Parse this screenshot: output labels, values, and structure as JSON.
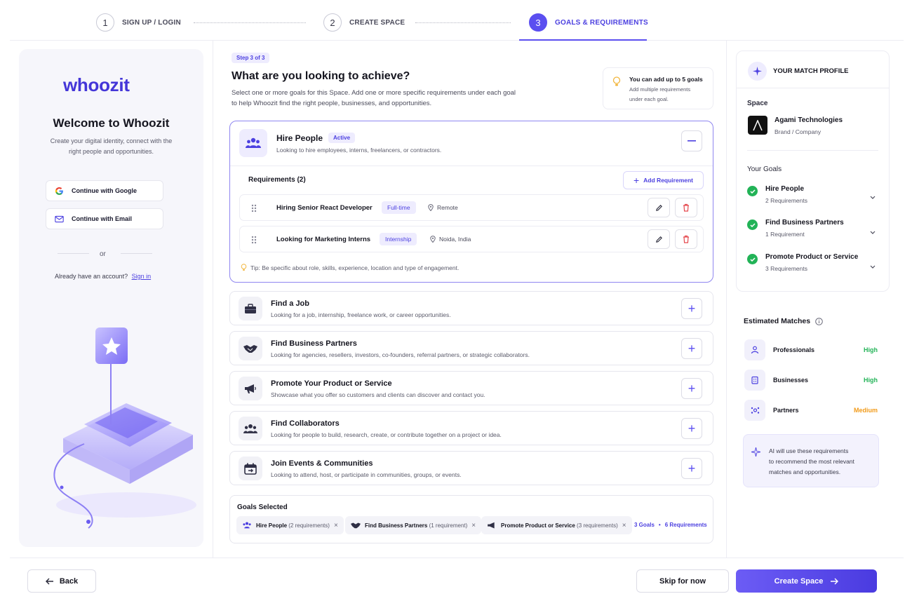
{
  "steps": [
    {
      "number": "1",
      "label": "SIGN UP / LOGIN"
    },
    {
      "number": "2",
      "label": "CREATE SPACE"
    },
    {
      "number": "3",
      "label": "GOALS & REQUIREMENTS"
    }
  ],
  "left": {
    "logo": "whoozit",
    "welcome_title": "Welcome to Whoozit",
    "welcome_sub_1": "Create your digital identity, connect with the",
    "welcome_sub_2": "right people and opportunities.",
    "google_label": "Continue with Google",
    "email_label": "Continue with Email",
    "or_label": "or",
    "account_text": "Already have an account?",
    "sign_in": "Sign in"
  },
  "main": {
    "step_badge": "Step 3 of 3",
    "title": "What are you looking to achieve?",
    "desc_1": "Select one or more goals for this Space. Add one or more specific requirements under each goal",
    "desc_2": "to help Whoozit find the right people, businesses, and opportunities.",
    "tip_title": "You can add up to 5 goals",
    "tip_sub_1": "Add multiple requirements",
    "tip_sub_2": "under each goal.",
    "active_goal": {
      "title": "Hire People",
      "badge": "Active",
      "sub": "Looking to hire employees, interns, freelancers, or contractors.",
      "requirements_label": "Requirements (2)",
      "add_req": "Add Requirement",
      "requirements": [
        {
          "title": "Hiring Senior React Developer",
          "tag": "Full-time",
          "location": "Remote"
        },
        {
          "title": "Looking for Marketing Interns",
          "tag": "Internship",
          "location": "Noida, India"
        }
      ],
      "tip": "Tip: Be specific about role, skills, experience, location and type of engagement."
    },
    "goals": [
      {
        "title": "Find a Job",
        "sub": "Looking for a job, internship, freelance work, or career opportunities.",
        "icon": "briefcase-icon"
      },
      {
        "title": "Find Business Partners",
        "sub": "Looking for agencies, resellers, investors, co-founders, referral partners, or strategic collaborators.",
        "icon": "handshake-icon"
      },
      {
        "title": "Promote Your Product or Service",
        "sub": "Showcase what you offer so customers and clients can discover and contact you.",
        "icon": "megaphone-icon"
      },
      {
        "title": "Find Collaborators",
        "sub": "Looking for people to build, research, create, or contribute together on a project or idea.",
        "icon": "people-icon"
      },
      {
        "title": "Join Events & Communities",
        "sub": "Looking to attend, host, or participate in communities, groups, or events.",
        "icon": "calendar-icon"
      }
    ],
    "selected": {
      "label": "Goals Selected",
      "chips": [
        {
          "name": "Hire People",
          "count": "(2 requirements)"
        },
        {
          "name": "Find Business Partners",
          "count": "(1 requirement)"
        },
        {
          "name": "Promote Product or Service",
          "count": "(3 requirements)"
        }
      ],
      "summary_goals": "3 Goals",
      "summary_sep": "•",
      "summary_reqs": "6 Requirements"
    }
  },
  "right": {
    "profile_title": "YOUR MATCH PROFILE",
    "space_label": "Space",
    "company_name": "Agami Technologies",
    "company_type": "Brand / Company",
    "goals_label": "Your Goals",
    "goals": [
      {
        "title": "Hire People",
        "sub": "2 Requirements"
      },
      {
        "title": "Find Business Partners",
        "sub": "1 Requirement"
      },
      {
        "title": "Promote Product or Service",
        "sub": "3 Requirements"
      }
    ],
    "estimated_label": "Estimated Matches",
    "matches": [
      {
        "label": "Professionals",
        "value": "High",
        "color": "#22b357"
      },
      {
        "label": "Businesses",
        "value": "High",
        "color": "#22b357"
      },
      {
        "label": "Partners",
        "value": "Medium",
        "color": "#f29b1a"
      }
    ],
    "ai_1": "AI will use these requirements",
    "ai_2": "to recommend the most relevant",
    "ai_3": "matches and opportunities."
  },
  "footer": {
    "back": "Back",
    "skip": "Skip for now",
    "create": "Create Space"
  },
  "colors": {
    "accent": "#5b4ff0",
    "success": "#22b357",
    "warning": "#f29b1a",
    "danger": "#e5484d"
  }
}
